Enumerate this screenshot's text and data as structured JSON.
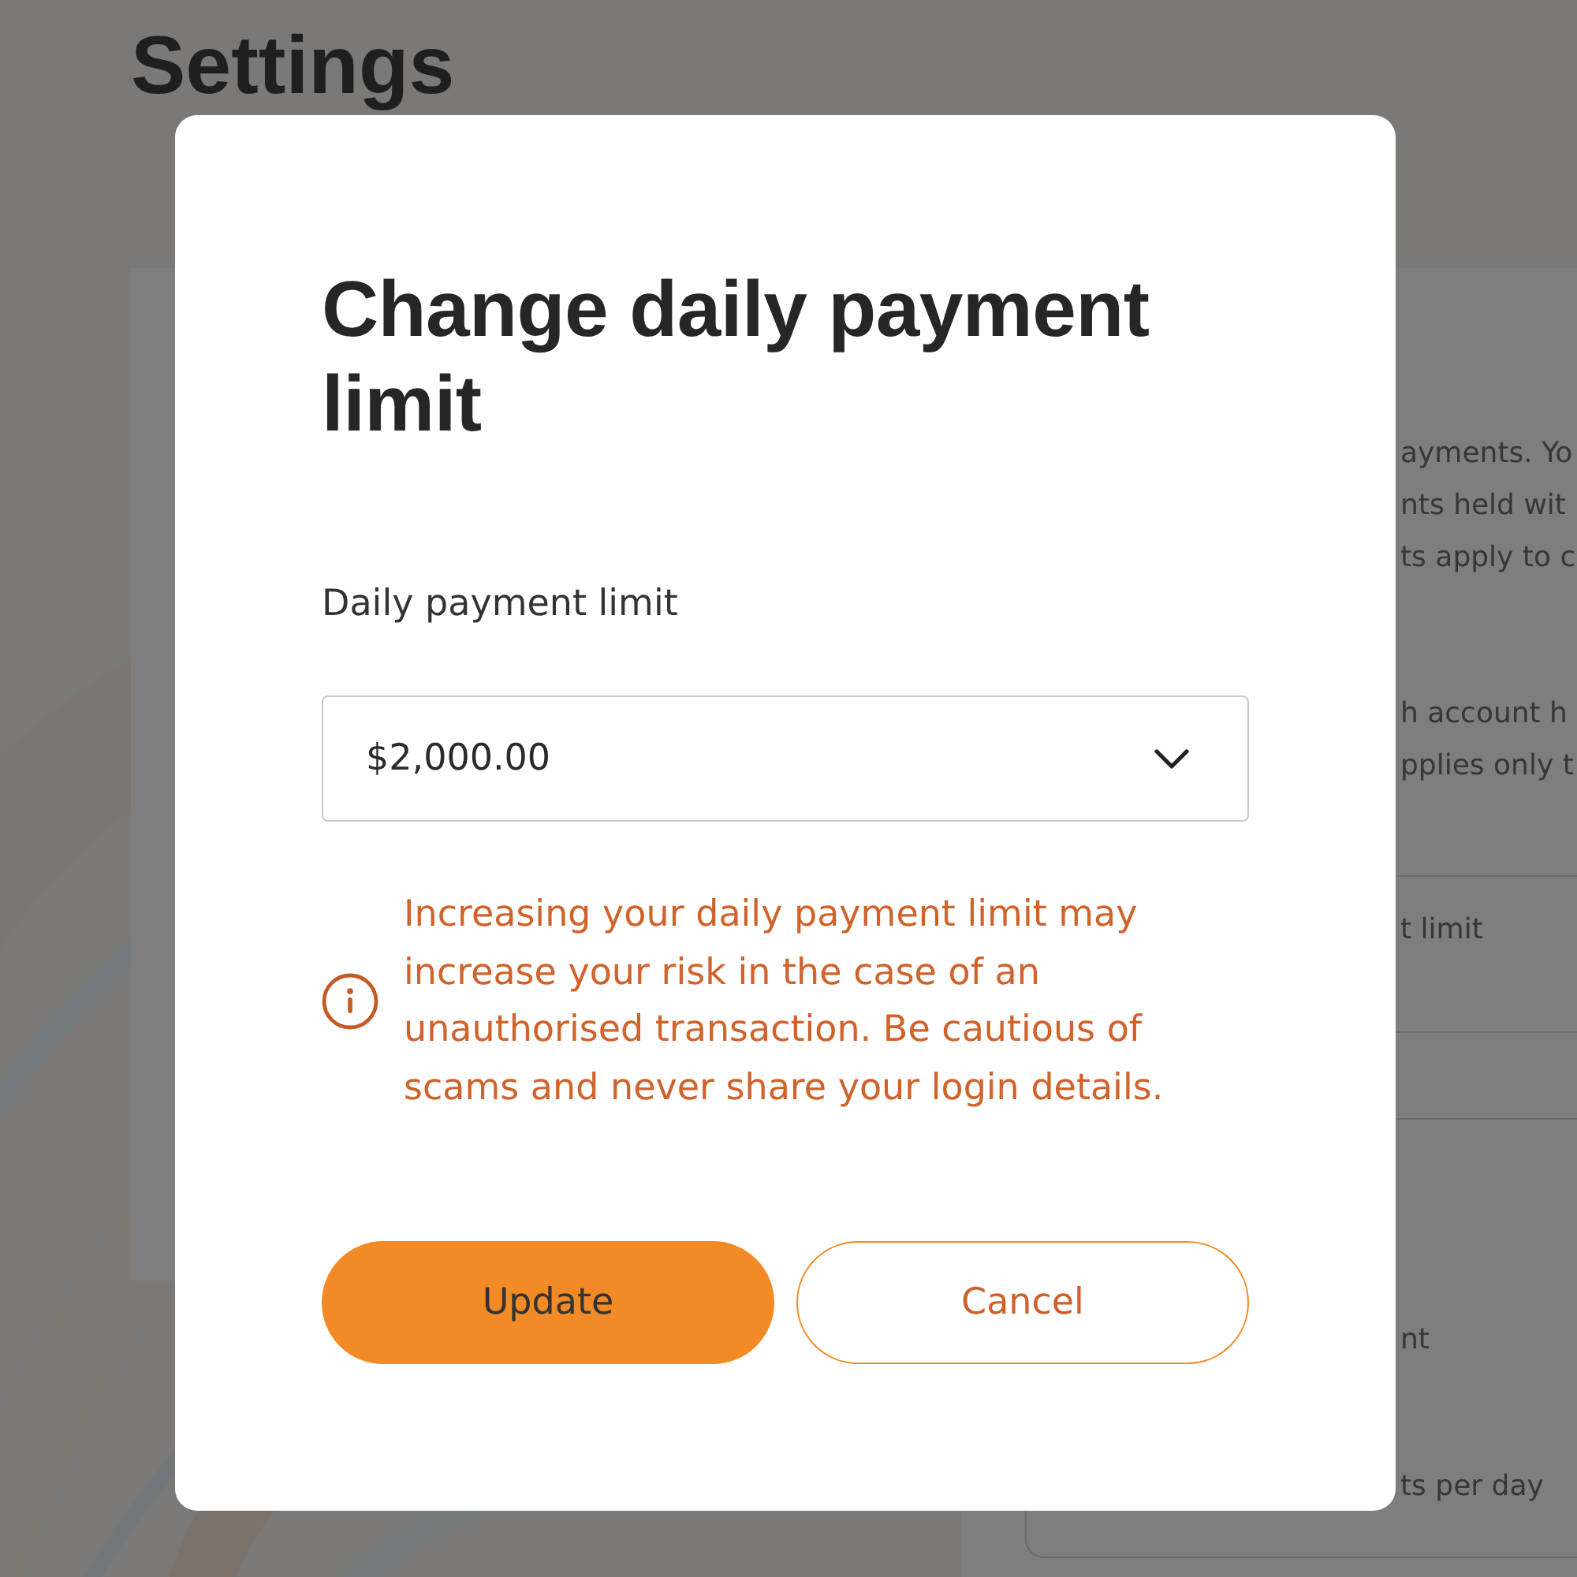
{
  "page": {
    "title": "Settings"
  },
  "settings_panel": {
    "intro_lines": [
      "ayments. Yo",
      "nts held wit",
      "ts apply to c"
    ],
    "account_lines": [
      "h account h",
      "pplies only t"
    ],
    "row_label": "t limit",
    "card_lines": [
      "nt",
      "ts per day"
    ]
  },
  "dialog": {
    "title": "Change daily payment limit",
    "field": {
      "label": "Daily payment limit",
      "value": "$2,000.00"
    },
    "warning": "Increasing your daily payment limit may increase your risk in the case of an unauthorised transaction. Be cautious of scams and never share your login details.",
    "buttons": [
      {
        "label": "Update",
        "kind": "primary"
      },
      {
        "label": "Cancel",
        "kind": "secondary"
      }
    ]
  }
}
